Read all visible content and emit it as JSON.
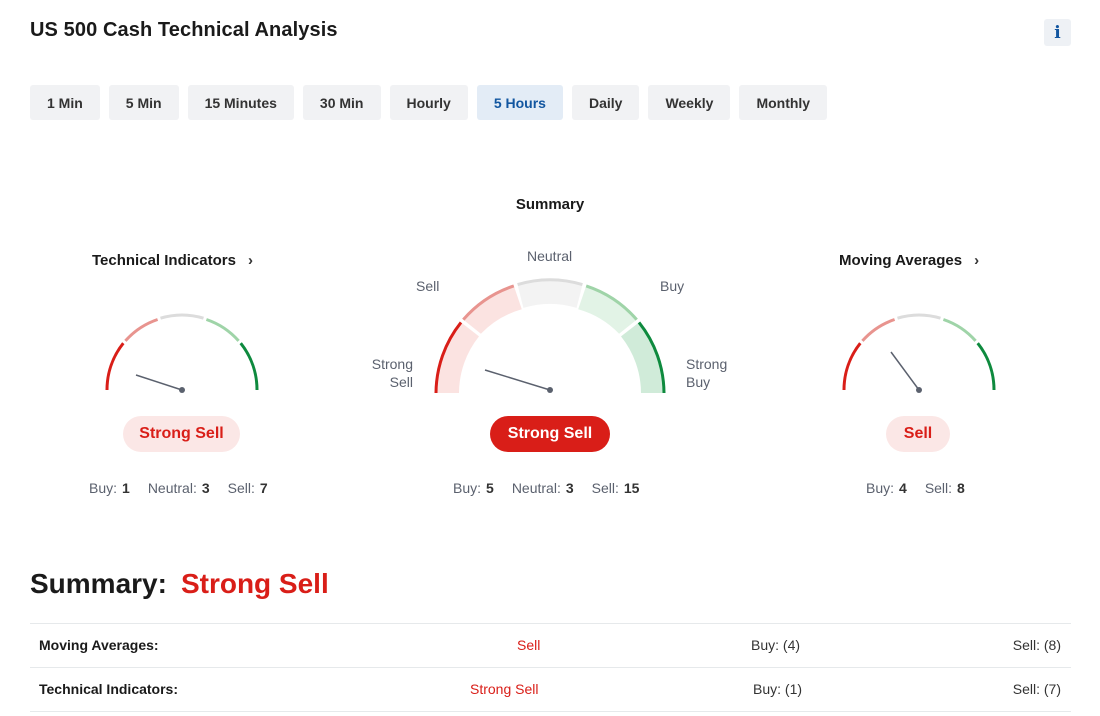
{
  "page": {
    "title": "US 500 Cash Technical Analysis",
    "info_icon": "info-icon",
    "info_label": "i"
  },
  "timeframes": [
    {
      "label": "1 Min",
      "active": false
    },
    {
      "label": "5 Min",
      "active": false
    },
    {
      "label": "15 Minutes",
      "active": false
    },
    {
      "label": "30 Min",
      "active": false
    },
    {
      "label": "Hourly",
      "active": false
    },
    {
      "label": "5 Hours",
      "active": true
    },
    {
      "label": "Daily",
      "active": false
    },
    {
      "label": "Weekly",
      "active": false
    },
    {
      "label": "Monthly",
      "active": false
    }
  ],
  "summary": {
    "heading": "Summary",
    "labels": {
      "strong_sell": "Strong\nSell",
      "sell": "Sell",
      "neutral": "Neutral",
      "buy": "Buy",
      "strong_buy": "Strong\nBuy"
    },
    "verdict": "Strong Sell",
    "counts": {
      "buy_label": "Buy:",
      "buy": "5",
      "neutral_label": "Neutral:",
      "neutral": "3",
      "sell_label": "Sell:",
      "sell": "15"
    }
  },
  "technical_indicators": {
    "title": "Technical Indicators",
    "chevron": ">",
    "verdict": "Strong Sell",
    "counts": {
      "buy_label": "Buy:",
      "buy": "1",
      "neutral_label": "Neutral:",
      "neutral": "3",
      "sell_label": "Sell:",
      "sell": "7"
    }
  },
  "moving_averages": {
    "title": "Moving Averages",
    "chevron": ">",
    "verdict": "Sell",
    "counts": {
      "buy_label": "Buy:",
      "buy": "4",
      "sell_label": "Sell:",
      "sell": "8"
    }
  },
  "gauge_colors": {
    "strong_sell": "#d91e18",
    "sell": "#e8948f",
    "neutral": "#dcdcdc",
    "buy": "#9fd4a8",
    "strong_buy": "#0e8a3e",
    "needle": "#5b616e"
  },
  "overall": {
    "label": "Summary:",
    "value": "Strong Sell",
    "rows": [
      {
        "name": "Moving Averages:",
        "verdict": "Sell",
        "buy": "Buy: (4)",
        "sell": "Sell: (8)"
      },
      {
        "name": "Technical Indicators:",
        "verdict": "Strong Sell",
        "buy": "Buy: (1)",
        "sell": "Sell: (7)"
      }
    ]
  }
}
